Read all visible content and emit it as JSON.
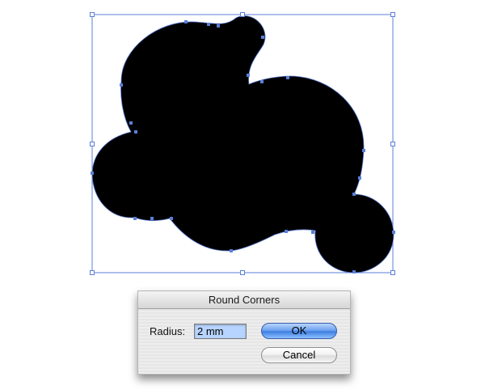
{
  "artwork": {
    "shape_color": "#000000",
    "selection_color": "#5b7fd8"
  },
  "dialog": {
    "title": "Round Corners",
    "radius_label": "Radius:",
    "radius_value": "2 mm",
    "ok_label": "OK",
    "cancel_label": "Cancel"
  }
}
